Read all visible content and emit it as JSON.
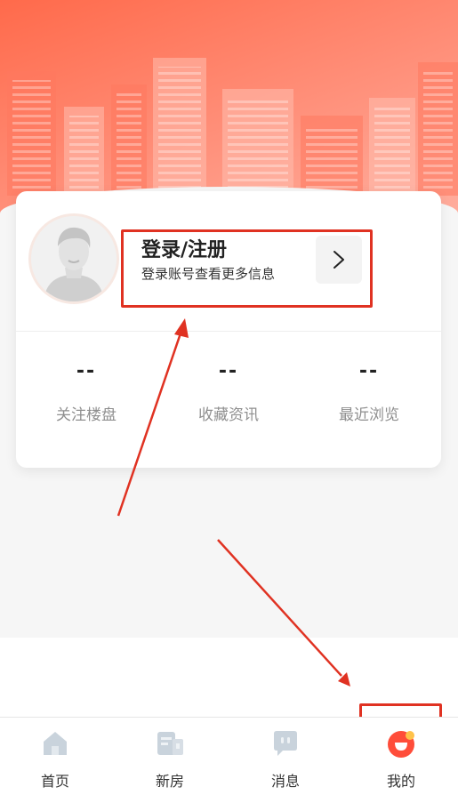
{
  "profile": {
    "login_title": "登录/注册",
    "login_subtitle": "登录账号查看更多信息"
  },
  "stats": [
    {
      "value": "--",
      "label": "关注楼盘"
    },
    {
      "value": "--",
      "label": "收藏资讯"
    },
    {
      "value": "--",
      "label": "最近浏览"
    }
  ],
  "tabs": [
    {
      "label": "首页",
      "icon": "home-icon"
    },
    {
      "label": "新房",
      "icon": "building-icon"
    },
    {
      "label": "消息",
      "icon": "message-icon"
    },
    {
      "label": "我的",
      "icon": "profile-icon"
    }
  ],
  "colors": {
    "brand": "#ff5a3c",
    "highlight": "#e03222",
    "tab_icon_gray": "#c9d3dc"
  }
}
